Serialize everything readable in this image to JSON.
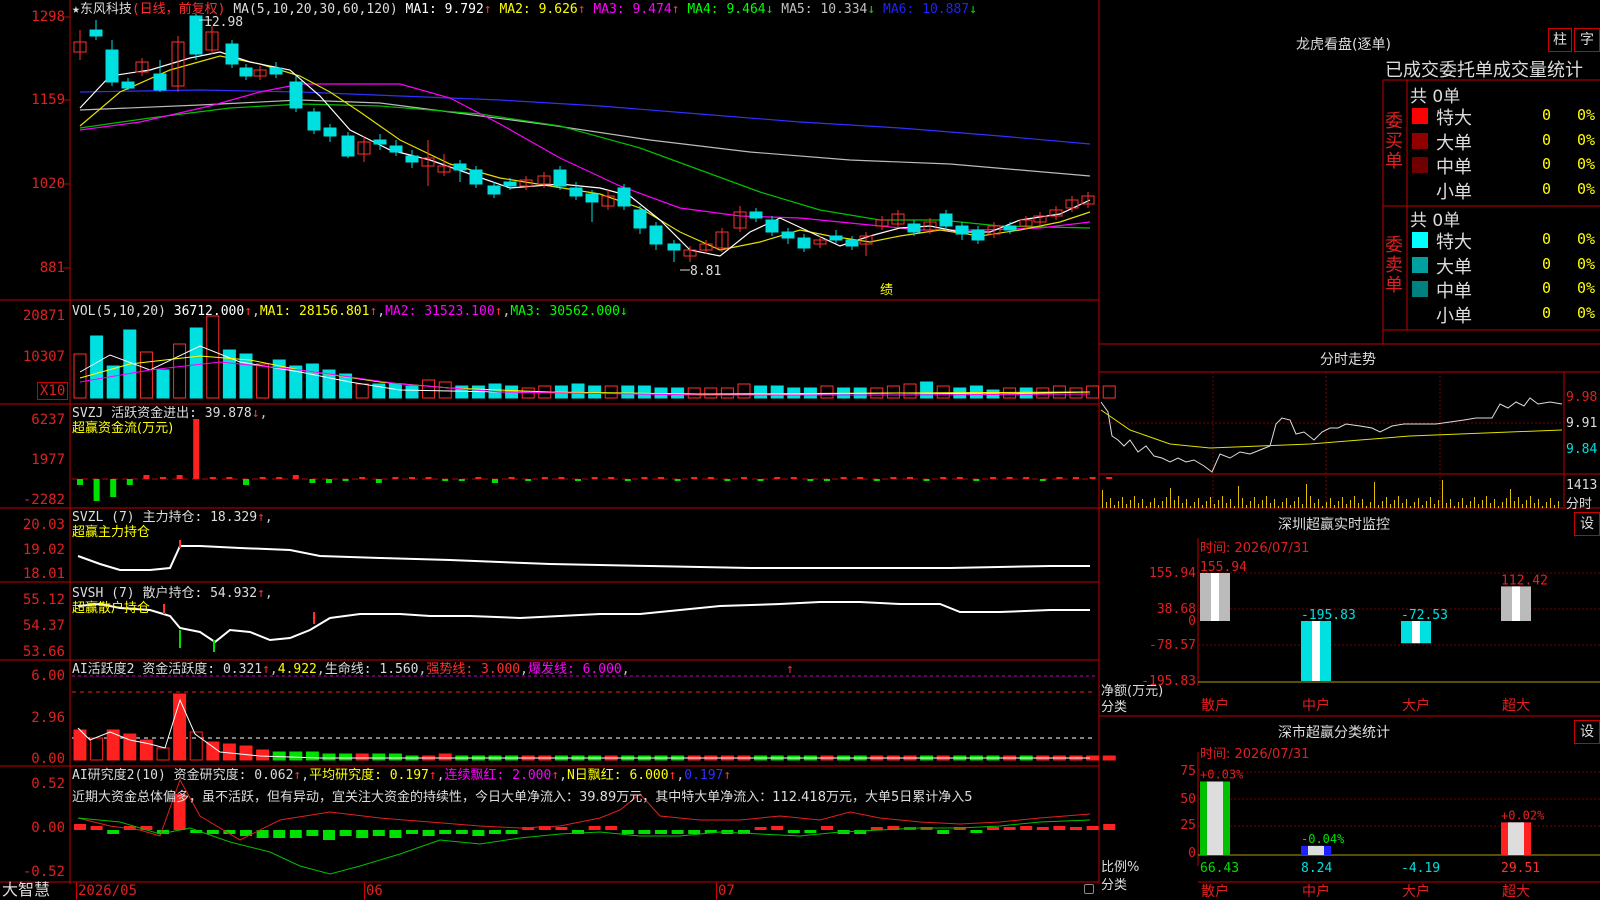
{
  "main": {
    "stock": "★东风科技",
    "period": "(日线，前复权)",
    "ma_params": "MA(5,10,20,30,60,120)",
    "ma": [
      {
        "label": "MA1: 9.792",
        "arrow": "↑",
        "color": "#ffffff"
      },
      {
        "label": "MA2: 9.626",
        "arrow": "↑",
        "color": "#ffff00"
      },
      {
        "label": "MA3: 9.474",
        "arrow": "↑",
        "color": "#ff00ff"
      },
      {
        "label": "MA4: 9.464",
        "arrow": "↓",
        "color": "#00ff00"
      },
      {
        "label": "MA5: 10.334",
        "arrow": "↓",
        "color": "#c0c0c0"
      },
      {
        "label": "MA6: 10.887",
        "arrow": "↓",
        "color": "#2020ff"
      }
    ],
    "y_labels": [
      "1298",
      "1159",
      "1020",
      "881"
    ],
    "high_mark": "12.98",
    "low_mark": "8.81",
    "event_mark": "绩"
  },
  "vol": {
    "label": "VOL(5,10,20)",
    "value": "36712.000",
    "ma1": "MA1: 28156.801",
    "ma2": "MA2: 31523.100",
    "ma3": "MA3: 30562.000",
    "y_labels": [
      "20871",
      "10307"
    ],
    "unit": "X10"
  },
  "svzj": {
    "label": "SVZJ  活跃资金进出: 39.878",
    "sub": "超赢资金流(万元)",
    "y_labels": [
      "6237",
      "1977",
      "-2282"
    ]
  },
  "svzl": {
    "label": "SVZL (7) 主力持仓: 18.329",
    "sub": "超赢主力持仓",
    "y_labels": [
      "20.03",
      "19.02",
      "18.01"
    ]
  },
  "svsh": {
    "label": "SVSH (7) 散户持仓: 54.932",
    "sub": "超赢散户持仓",
    "y_labels": [
      "55.12",
      "54.37",
      "53.66"
    ]
  },
  "ai1": {
    "label": "AI活跃度2 资金活跃度: 0.321",
    "v2": "4.922",
    "v3": "生命线: 1.560",
    "v4": "强势线: 3.000",
    "v5": "爆发线: 6.000",
    "y_labels": [
      "6.00",
      "2.96",
      "0.00"
    ]
  },
  "ai2": {
    "label": "AI研究度2(10) 资金研究度: 0.062",
    "v2": "平均研究度: 0.197",
    "v3": "连续飘红: 2.000",
    "v4": "N日飘红: 6.000",
    "v5": "0.197",
    "commentary": "近期大资金总体偏多，虽不活跃，但有异动，宜关注大资金的持续性，今日大单净流入：39.89万元，其中特大单净流入：112.418万元，大单5日累计净入5",
    "y_labels": [
      "0.52",
      "0.00",
      "-0.52"
    ]
  },
  "xaxis": {
    "labels": [
      "2026/05",
      "06",
      "07"
    ]
  },
  "brand": "大智慧",
  "right": {
    "lhb_title": "龙虎看盘(逐单)",
    "btn_zhu": "柱",
    "btn_zi": "字",
    "table_title": "已成交委托单成交量统计",
    "buy": {
      "side": "委买单",
      "total": "共 0单",
      "rows": [
        {
          "name": "特大",
          "count": "0",
          "pct": "0%",
          "color": "#ff0000"
        },
        {
          "name": "大单",
          "count": "0",
          "pct": "0%",
          "color": "#900000"
        },
        {
          "name": "中单",
          "count": "0",
          "pct": "0%",
          "color": "#700000"
        },
        {
          "name": "小单",
          "count": "0",
          "pct": "0%",
          "color": "#000000"
        }
      ]
    },
    "sell": {
      "side": "委卖单",
      "total": "共 0单",
      "rows": [
        {
          "name": "特大",
          "count": "0",
          "pct": "0%",
          "color": "#00ffff"
        },
        {
          "name": "大单",
          "count": "0",
          "pct": "0%",
          "color": "#00a0a0"
        },
        {
          "name": "中单",
          "count": "0",
          "pct": "0%",
          "color": "#008080"
        },
        {
          "name": "小单",
          "count": "0",
          "pct": "0%",
          "color": "#000000"
        }
      ]
    },
    "intraday": {
      "title": "分时走势",
      "prices": [
        "9.98",
        "9.91",
        "9.84"
      ],
      "vol_label": "1413",
      "vol_unit": "分时"
    },
    "monitor": {
      "title": "深圳超赢实时监控",
      "btn": "设",
      "time": "时间: 2026/07/31",
      "y_labels": [
        "155.94",
        "38.68",
        "0",
        "-78.57",
        "-195.83"
      ],
      "axis_label_1": "净额(万元)",
      "axis_label_2": "分类",
      "bars": [
        {
          "cat": "散户",
          "value": 155.94,
          "label": "155.94"
        },
        {
          "cat": "中户",
          "value": -195.83,
          "label": "-195.83"
        },
        {
          "cat": "大户",
          "value": -72.53,
          "label": "-72.53"
        },
        {
          "cat": "超大",
          "value": 112.42,
          "label": "112.42"
        }
      ]
    },
    "classify": {
      "title": "深市超赢分类统计",
      "btn": "设",
      "time": "时间: 2026/07/31",
      "y_labels": [
        "75",
        "50",
        "25",
        "0"
      ],
      "axis_label_1": "比例%",
      "axis_label_2": "分类",
      "bars": [
        {
          "cat": "散户",
          "value": 66.43,
          "label": "66.43",
          "change": "+0.03%"
        },
        {
          "cat": "中户",
          "value": 8.24,
          "label": "8.24",
          "change": "-0.04%"
        },
        {
          "cat": "大户",
          "value": -4.19,
          "label": "-4.19",
          "change": ""
        },
        {
          "cat": "超大",
          "value": 29.51,
          "label": "29.51",
          "change": "+0.02%"
        }
      ]
    }
  }
}
